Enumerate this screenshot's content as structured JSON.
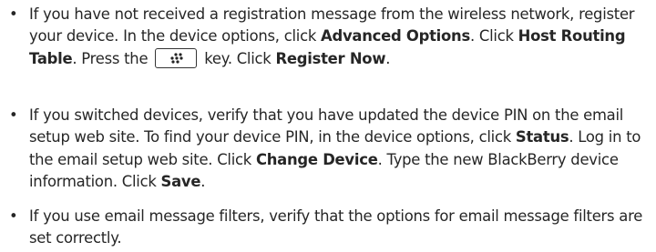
{
  "list": {
    "bullet_glyph": "•",
    "items": [
      {
        "segments": [
          {
            "t": "If you have not received a registration message from the wireless network, register your device. In the device options, click "
          },
          {
            "b": "Advanced Options"
          },
          {
            "t": ". Click "
          },
          {
            "b": "Host Routing Table"
          },
          {
            "t": ". Press the "
          },
          {
            "key": "menu-key-icon"
          },
          {
            "t": " key. Click "
          },
          {
            "b": "Register Now"
          },
          {
            "t": "."
          }
        ]
      },
      {
        "segments": [
          {
            "t": "If you switched devices, verify that you have updated the device PIN on the email setup web site. To find your device PIN, in the device options, click "
          },
          {
            "b": "Status"
          },
          {
            "t": ". Log in to the email setup web site. Click "
          },
          {
            "b": "Change Device"
          },
          {
            "t": ". Type the new BlackBerry device information. Click "
          },
          {
            "b": "Save"
          },
          {
            "t": "."
          }
        ]
      },
      {
        "segments": [
          {
            "t": "If you use email message filters, verify that the options for email message filters are set correctly."
          }
        ]
      }
    ]
  }
}
